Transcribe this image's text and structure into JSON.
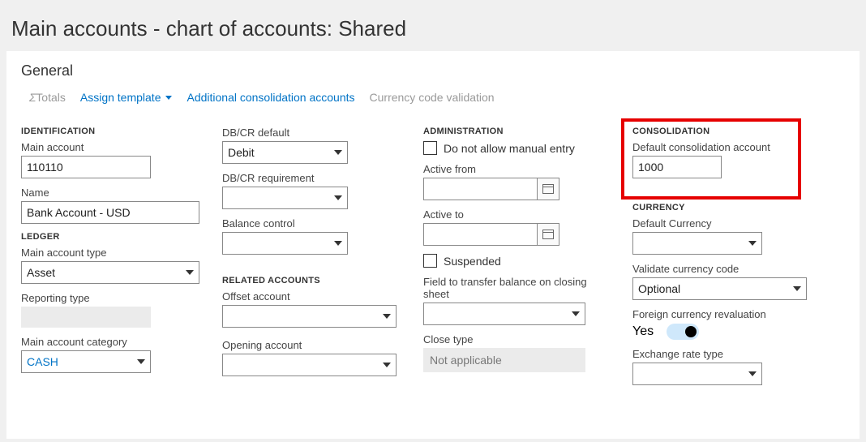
{
  "page_title": "Main accounts - chart of accounts: Shared",
  "panel_title": "General",
  "toolbar": {
    "totals": "Totals",
    "assign_template": "Assign template",
    "additional_consolidation": "Additional consolidation accounts",
    "currency_code_validation": "Currency code validation"
  },
  "identification": {
    "heading": "IDENTIFICATION",
    "main_account_label": "Main account",
    "main_account_value": "110110",
    "name_label": "Name",
    "name_value": "Bank Account - USD"
  },
  "ledger": {
    "heading": "LEDGER",
    "main_account_type_label": "Main account type",
    "main_account_type_value": "Asset",
    "reporting_type_label": "Reporting type",
    "main_account_category_label": "Main account category",
    "main_account_category_value": "CASH"
  },
  "dbcr": {
    "default_label": "DB/CR default",
    "default_value": "Debit",
    "requirement_label": "DB/CR requirement",
    "requirement_value": "",
    "balance_label": "Balance control",
    "balance_value": ""
  },
  "related": {
    "heading": "RELATED ACCOUNTS",
    "offset_label": "Offset account",
    "offset_value": "",
    "opening_label": "Opening account",
    "opening_value": ""
  },
  "admin": {
    "heading": "ADMINISTRATION",
    "do_not_allow": "Do not allow manual entry",
    "active_from_label": "Active from",
    "active_to_label": "Active to",
    "suspended": "Suspended",
    "field_transfer_label": "Field to transfer balance on closing sheet",
    "field_transfer_value": "",
    "close_type_label": "Close type",
    "close_type_value": "Not applicable"
  },
  "consolidation": {
    "heading": "CONSOLIDATION",
    "default_label": "Default consolidation account",
    "default_value": "1000"
  },
  "currency": {
    "heading": "CURRENCY",
    "default_label": "Default Currency",
    "default_value": "",
    "validate_label": "Validate currency code",
    "validate_value": "Optional",
    "foreign_label": "Foreign currency revaluation",
    "foreign_value": "Yes",
    "exchange_label": "Exchange rate type",
    "exchange_value": ""
  }
}
